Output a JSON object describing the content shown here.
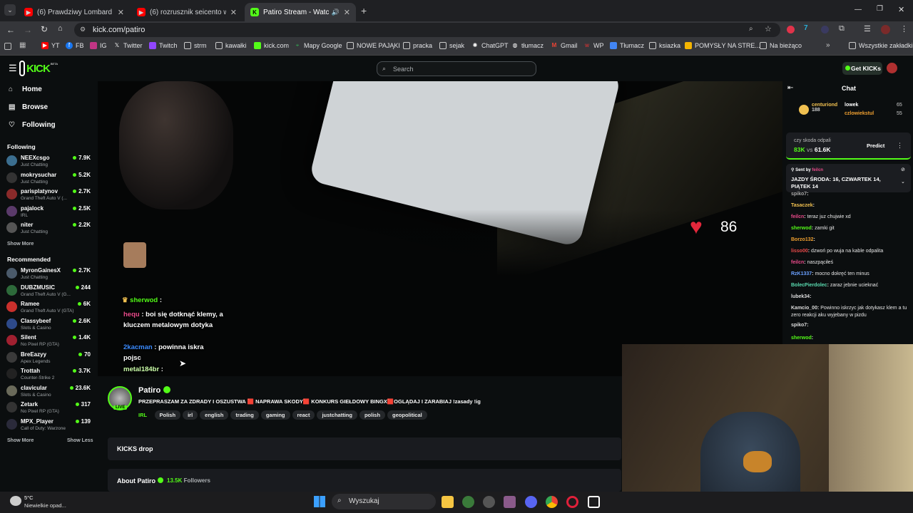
{
  "browser": {
    "tabs": [
      {
        "title": "(6) Prawdziwy Lombard - Odcin",
        "color": "#ff0000"
      },
      {
        "title": "(6) rozrusznik seicento wymiana",
        "color": "#ff0000"
      },
      {
        "title": "Patiro Stream - Watch Live",
        "color": "#53fc18"
      }
    ],
    "url": "kick.com/patiro",
    "bookmarks": [
      "YT",
      "FB",
      "IG",
      "Twitter",
      "Twitch",
      "strm",
      "kawałki",
      "kick.com",
      "Mapy Google",
      "NOWE PAJĄKI",
      "pracka",
      "sejak",
      "ChatGPT",
      "tłumacz",
      "Gmail",
      "WP",
      "Tłumacz",
      "ksiazka",
      "POMYSŁY NA STRE...",
      "Na bieżąco"
    ],
    "all_bookmarks": "Wszystkie zakładki"
  },
  "kick": {
    "logo_text": "KICK",
    "beta": "BETA",
    "search_placeholder": "Search",
    "get_kicks": "Get KICKs"
  },
  "sidebar": {
    "nav": [
      {
        "label": "Home",
        "icon": "home-icon"
      },
      {
        "label": "Browse",
        "icon": "browse-icon"
      },
      {
        "label": "Following",
        "icon": "heart-icon"
      }
    ],
    "following_title": "Following",
    "following": [
      {
        "name": "NEEXcsgo",
        "game": "Just Chatting",
        "viewers": "7.9K",
        "color": "#3b6e8f"
      },
      {
        "name": "mokrysuchar",
        "game": "Just Chatting",
        "viewers": "5.2K",
        "color": "#333"
      },
      {
        "name": "parisplatynov",
        "game": "Grand Theft Auto V (...",
        "viewers": "2.7K",
        "color": "#8a2a2a"
      },
      {
        "name": "pajalock",
        "game": "IRL",
        "viewers": "2.5K",
        "color": "#5a3a6a"
      },
      {
        "name": "niter",
        "game": "Just Chatting",
        "viewers": "2.2K",
        "color": "#555"
      }
    ],
    "show_more": "Show More",
    "recommended_title": "Recommended",
    "recommended": [
      {
        "name": "MyronGainesX",
        "game": "Just Chatting",
        "viewers": "2.7K",
        "color": "#4a5a6a"
      },
      {
        "name": "DUBZMUSIC",
        "game": "Grand Theft Auto V (G...",
        "viewers": "244",
        "color": "#2d6a3a"
      },
      {
        "name": "Ramee",
        "game": "Grand Theft Auto V (GTA)",
        "viewers": "6K",
        "color": "#c9302c"
      },
      {
        "name": "Classybeef",
        "game": "Slots & Casino",
        "viewers": "2.6K",
        "color": "#2d4a8a"
      },
      {
        "name": "Silent",
        "game": "No Pixel RP (GTA)",
        "viewers": "1.4K",
        "color": "#a02030"
      },
      {
        "name": "BreEazyy",
        "game": "Apex Legends",
        "viewers": "70",
        "color": "#3a3a3a"
      },
      {
        "name": "Trottah",
        "game": "Counter-Strike 2",
        "viewers": "3.7K",
        "color": "#222"
      },
      {
        "name": "clavicular",
        "game": "Slots & Casino",
        "viewers": "23.6K",
        "color": "#6a6a5a"
      },
      {
        "name": "Zetark",
        "game": "No Pixel RP (GTA)",
        "viewers": "317",
        "color": "#333"
      },
      {
        "name": "MPX_Player",
        "game": "Call of Duty: Warzone",
        "viewers": "139",
        "color": "#2a2a3a"
      }
    ],
    "show_less": "Show Less"
  },
  "player": {
    "heart_rate": "86",
    "overlay_chat": [
      {
        "user": "sherwod",
        "text": "",
        "color": "#53fc18"
      },
      {
        "user": "hequ",
        "text": "boi się dotknąć klemy, a kluczem metalowym dotyka",
        "color": "#e94a8a"
      },
      {
        "user": "2kacman",
        "text": "powinna iskra pojsc",
        "color": "#3b8bff"
      },
      {
        "user": "metal184br",
        "text": "",
        "color": "#cfa"
      }
    ]
  },
  "stream": {
    "streamer": "Patiro",
    "live_label": "LIVE",
    "title": "PRZEPRASZAM ZA ZDRADY I OSZUSTWA 🟥 NAPRAWA SKODY🟥 KONKURS GIEŁDOWY BINGX🟥OGLĄDAJ I ZARABIAJ !zasady !ig",
    "category": "IRL",
    "tags": [
      "Polish",
      "irl",
      "english",
      "trading",
      "gaming",
      "react",
      "justchatting",
      "polish",
      "geopolitical"
    ],
    "kicks_drop": "KICKS drop",
    "about": "About Patiro",
    "followers": "13.5K",
    "followers_label": "Followers"
  },
  "chat": {
    "title": "Chat",
    "leaders": [
      {
        "name": "centuriond",
        "value": "188"
      },
      {
        "name": "lowek",
        "value": "65"
      },
      {
        "name": "czlowiekstul",
        "value": "55"
      }
    ],
    "prediction": {
      "question": "czy skoda odpali",
      "a": "83K",
      "vs": "vs",
      "b": "61.6K",
      "button": "Predict"
    },
    "pinned": {
      "sent_by": "Sent by",
      "user": "feilcn",
      "text": "JAZDY ŚRODA: 16, CZWARTEK 14, PIĄTEK 14"
    },
    "messages": [
      {
        "user": "spiko7",
        "text": "",
        "color": "#aaa"
      },
      {
        "user": "Tasaczek",
        "text": "",
        "color": "#f0c050"
      },
      {
        "user": "feilcn",
        "text": "teraz juz chujwie xd",
        "color": "#e94a8a"
      },
      {
        "user": "sherwod",
        "text": "zamki git",
        "color": "#53fc18"
      },
      {
        "user": "Borzo132",
        "text": "",
        "color": "#f0a030"
      },
      {
        "user": "lisso00",
        "text": "dzwoń po wuja na kable odpalita",
        "color": "#e94a4a"
      },
      {
        "user": "feilcn",
        "text": "naszpąciłeś",
        "color": "#e94a8a"
      },
      {
        "user": "RzK1337",
        "text": "mocno dokręć ten minus",
        "color": "#6aa0ff"
      },
      {
        "user": "BolecPierdolec",
        "text": "zaraz jebnie ucieknać",
        "color": "#5adbb0"
      },
      {
        "user": "lubek34",
        "text": "",
        "color": "#ddd"
      },
      {
        "user": "Kamcio_00",
        "text": "Powinno iskrzyc jak dotykasz klem a tu zero reakcji aku wyjebany w pizdu",
        "color": "#ddd"
      },
      {
        "user": "spiko7",
        "text": "",
        "color": "#ddd"
      },
      {
        "user": "sherwod",
        "text": "",
        "color": "#53fc18"
      }
    ]
  },
  "taskbar": {
    "temp": "5°C",
    "weather": "Niewielkie opad...",
    "search": "Wyszukaj"
  },
  "colors": {
    "accent": "#53fc18",
    "bg": "#0b0e0f",
    "panel": "#191b1f"
  }
}
